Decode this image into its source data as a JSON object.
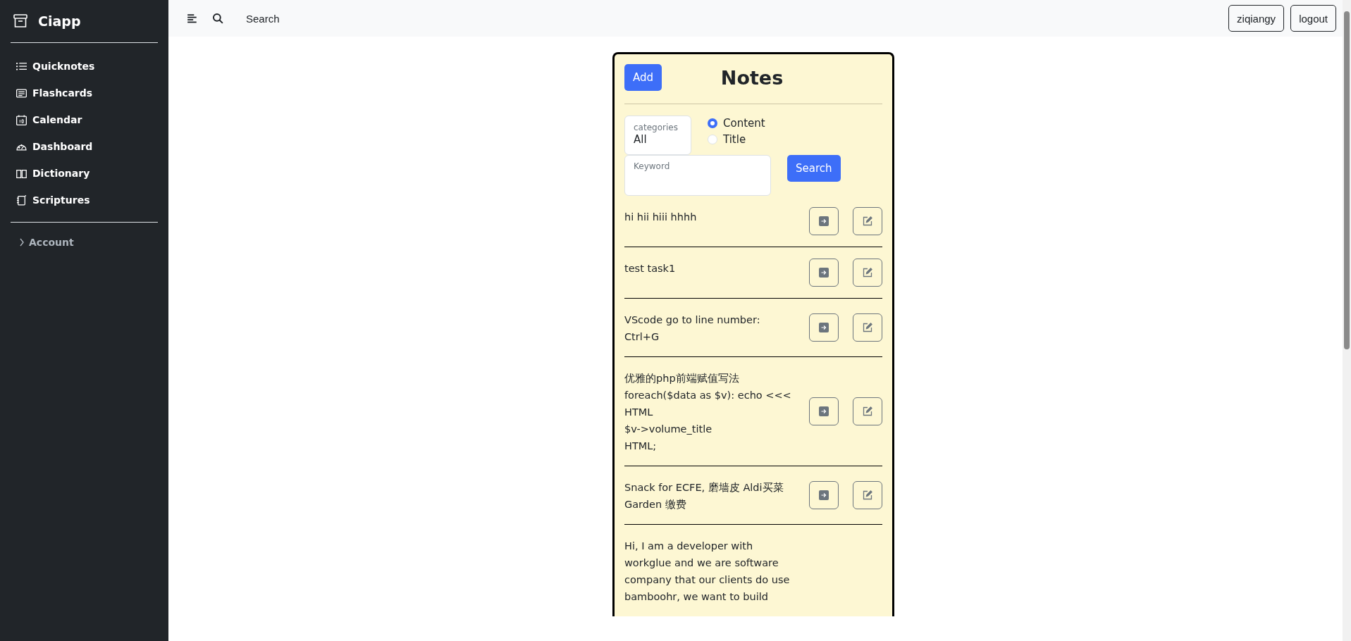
{
  "sidebar": {
    "brand": "Ciapp",
    "items": [
      {
        "label": "Quicknotes",
        "kind": "list"
      },
      {
        "label": "Flashcards",
        "kind": "card"
      },
      {
        "label": "Calendar",
        "kind": "calendar"
      },
      {
        "label": "Dashboard",
        "kind": "gauge"
      },
      {
        "label": "Dictionary",
        "kind": "book"
      },
      {
        "label": "Scriptures",
        "kind": "notebook"
      }
    ],
    "account": {
      "label": "Account",
      "expanded": false
    }
  },
  "topbar": {
    "search": "Search",
    "user": "ziqiangy",
    "logout": "logout"
  },
  "notes": {
    "add": "Add",
    "title": "Notes",
    "category": {
      "label": "categories",
      "value": "All"
    },
    "search_by": [
      {
        "label": "Content",
        "selected": true
      },
      {
        "label": "Title",
        "selected": false
      }
    ],
    "keyword": {
      "placeholder": "Keyword"
    },
    "search_button": "Search",
    "items": [
      {
        "text": "hi hii hiii hhhh",
        "actions": true
      },
      {
        "text": "test task1",
        "actions": true
      },
      {
        "text": "VScode go to line number:\nCtrl+G",
        "actions": true
      },
      {
        "text": "优雅的php前端赋值写法\nforeach($data as $v): echo <<<\nHTML\n $v->volume_title\nHTML;",
        "actions": true
      },
      {
        "text": "Snack for ECFE, 磨墙皮 Aldi买菜\nGarden 缴费",
        "actions": true
      },
      {
        "text": "Hi, I am a developer with\nworkglue and we are software\ncompany that our clients do use\nbamboohr, we want to build",
        "actions": false
      }
    ]
  }
}
